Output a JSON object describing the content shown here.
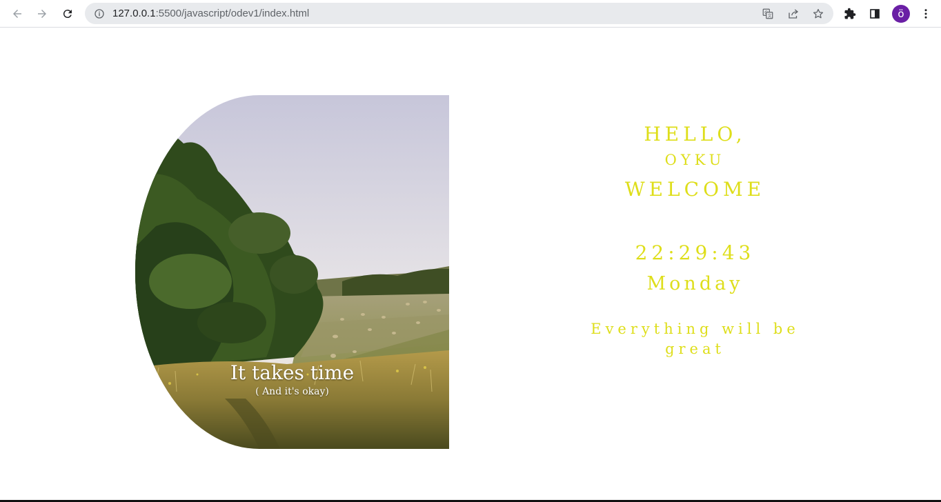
{
  "browser": {
    "back_icon": "arrow-left-icon",
    "forward_icon": "arrow-right-icon",
    "reload_icon": "reload-icon",
    "site_info_icon": "info-icon",
    "url_host": "127.0.0.1",
    "url_rest": ":5500/javascript/odev1/index.html",
    "translate_icon": "translate-icon",
    "share_icon": "share-icon",
    "bookmark_icon": "star-icon",
    "extensions_icon": "puzzle-icon",
    "sidepanel_icon": "side-panel-icon",
    "profile_initial": "ö",
    "menu_icon": "kebab-menu-icon"
  },
  "photo": {
    "caption_main": "It takes time",
    "caption_sub": "( And it's okay)"
  },
  "greeting": {
    "hello": "HELLO,",
    "user_name": "OYKU",
    "welcome": "WELCOME"
  },
  "clock": {
    "time": "22:29:43",
    "day": "Monday"
  },
  "motto": "Everything will be great",
  "colors": {
    "text_accent": "#dede1a",
    "avatar": "#6a1fa5"
  }
}
